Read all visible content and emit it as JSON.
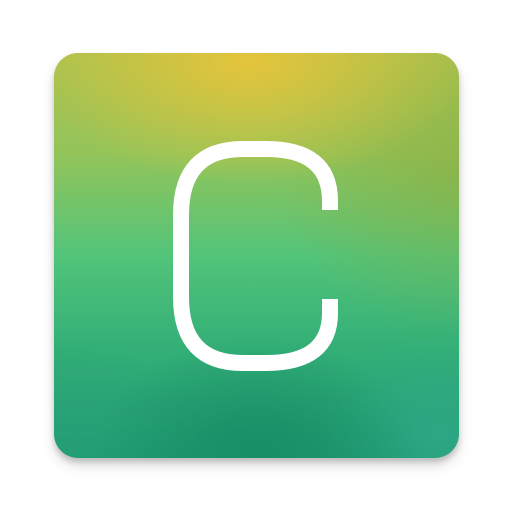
{
  "icon": {
    "letter": "C",
    "glyph_color": "#ffffff",
    "gradient_colors": [
      "#e8c43a",
      "#a9c24f",
      "#52c47a",
      "#1f9a72"
    ]
  }
}
